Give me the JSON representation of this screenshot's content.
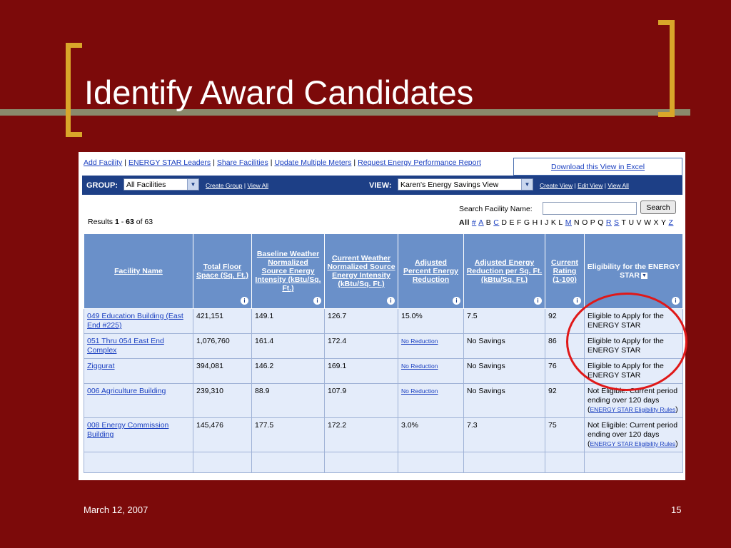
{
  "slide": {
    "title": "Identify Award Candidates",
    "date": "March 12, 2007",
    "page_number": "15"
  },
  "topnav": {
    "links": [
      "Add Facility",
      "ENERGY STAR Leaders",
      "Share Facilities",
      "Update Multiple Meters",
      "Request Energy Performance Report"
    ],
    "separator": "|",
    "download_excel": "Download this View in Excel"
  },
  "group_bar": {
    "group_label": "GROUP:",
    "group_value": "All Facilities",
    "group_links": [
      "Create Group",
      "View All"
    ],
    "view_label": "VIEW:",
    "view_value": "Karen's Energy Savings View",
    "view_links": [
      "Create View",
      "Edit View",
      "View All"
    ]
  },
  "results": {
    "prefix": "Results",
    "start": "1",
    "dash": "-",
    "end": "63",
    "of": "of",
    "total": "63"
  },
  "search": {
    "label": "Search Facility Name:",
    "value": "",
    "button": "Search"
  },
  "alphabet": [
    {
      "t": "All",
      "link": false
    },
    {
      "t": "#",
      "link": true
    },
    {
      "t": "A",
      "link": true
    },
    {
      "t": "B",
      "link": false
    },
    {
      "t": "C",
      "link": true
    },
    {
      "t": "D",
      "link": false
    },
    {
      "t": "E",
      "link": false
    },
    {
      "t": "F",
      "link": false
    },
    {
      "t": "G",
      "link": false
    },
    {
      "t": "H",
      "link": false
    },
    {
      "t": "I",
      "link": false
    },
    {
      "t": "J",
      "link": false
    },
    {
      "t": "K",
      "link": false
    },
    {
      "t": "L",
      "link": false
    },
    {
      "t": "M",
      "link": true
    },
    {
      "t": "N",
      "link": false
    },
    {
      "t": "O",
      "link": false
    },
    {
      "t": "P",
      "link": false
    },
    {
      "t": "Q",
      "link": false
    },
    {
      "t": "R",
      "link": true
    },
    {
      "t": "S",
      "link": true
    },
    {
      "t": "T",
      "link": false
    },
    {
      "t": "U",
      "link": false
    },
    {
      "t": "V",
      "link": false
    },
    {
      "t": "W",
      "link": false
    },
    {
      "t": "X",
      "link": false
    },
    {
      "t": "Y",
      "link": false
    },
    {
      "t": "Z",
      "link": true
    }
  ],
  "table": {
    "headers": [
      "Facility Name",
      "Total Floor Space (Sq. Ft.)",
      "Baseline Weather Normalized Source Energy Intensity (kBtu/Sq. Ft.)",
      "Current Weather Normalized Source Energy Intensity (kBtu/Sq. Ft.)",
      "Adjusted Percent Energy Reduction",
      "Adjusted Energy Reduction per Sq. Ft. (kBtu/Sq. Ft.)",
      "Current Rating (1-100)",
      "Eligibility for the ENERGY STAR"
    ],
    "info_glyph": "i",
    "dropdown_glyph": "▼",
    "rows": [
      {
        "name": "049 Education Building (East End #225)",
        "floor": "421,151",
        "baseline": "149.1",
        "current": "126.7",
        "pct": "15.0%",
        "pct_link": false,
        "per_sqft": "7.5",
        "rating": "92",
        "eligibility": "Eligible to Apply for the ENERGY STAR",
        "rules_link": ""
      },
      {
        "name": "051 Thru 054 East End Complex",
        "floor": "1,076,760",
        "baseline": "161.4",
        "current": "172.4",
        "pct": "No Reduction",
        "pct_link": true,
        "per_sqft": "No Savings",
        "rating": "86",
        "eligibility": "Eligible to Apply for the ENERGY STAR",
        "rules_link": ""
      },
      {
        "name": "Ziggurat",
        "floor": "394,081",
        "baseline": "146.2",
        "current": "169.1",
        "pct": "No Reduction",
        "pct_link": true,
        "per_sqft": "No Savings",
        "rating": "76",
        "eligibility": "Eligible to Apply for the ENERGY STAR",
        "rules_link": ""
      },
      {
        "name": "006 Agriculture Building",
        "floor": "239,310",
        "baseline": "88.9",
        "current": "107.9",
        "pct": "No Reduction",
        "pct_link": true,
        "per_sqft": "No Savings",
        "rating": "92",
        "eligibility": "Not Eligible: Current period ending over 120 days (",
        "rules_link": "ENERGY STAR Eligibility Rules"
      },
      {
        "name": "008 Energy Commission Building",
        "floor": "145,476",
        "baseline": "177.5",
        "current": "172.2",
        "pct": "3.0%",
        "pct_link": false,
        "per_sqft": "7.3",
        "rating": "75",
        "eligibility": "Not Eligible: Current period ending over 120 days (",
        "rules_link": "ENERGY STAR Eligibility Rules"
      }
    ]
  },
  "colors": {
    "slide_bg": "#7c0a0a",
    "bracket": "#d9a62a",
    "header_bar": "#1d3f86",
    "table_header": "#6a90c9",
    "row_bg": "#e4ecfa",
    "highlight_circle": "#e01818"
  }
}
